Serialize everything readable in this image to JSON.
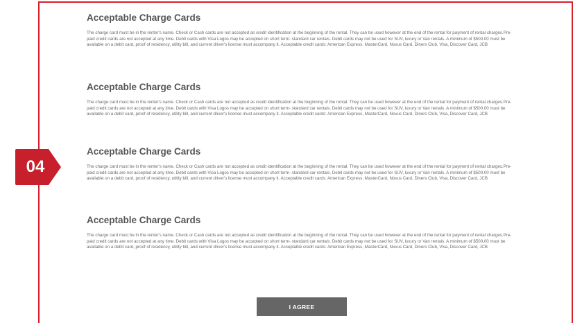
{
  "step": {
    "number": "04",
    "color": "#c81f2c"
  },
  "panel": {
    "border_color": "#d71f2b"
  },
  "sections": [
    {
      "title": "Acceptable Charge Cards",
      "body": "The charge card must be in the renter's name. Check or Cash cards are not accepted as credit identification at the beginning of the rental. They can be used however at the end of the rental for payment of rental charges.Pre-paid credit cards are not accepted at any time. Debit cards with Visa Logos may be accepted on short term- standard car rentals. Debit cards may not be used for SUV, luxury or Van rentals. A minimum of $500.00 must be available on a debit card, proof of residency, utility bill, and current driver's license must accompany it. Acceptable credit cards: American Express, MasterCard, Novus Card, Diners Club, Visa, Discover Card, JCB"
    },
    {
      "title": "Acceptable Charge Cards",
      "body": "The charge card must be in the renter's name. Check or Cash cards are not accepted as credit identification at the beginning of the rental. They can be used however at the end of the rental for payment of rental charges.Pre-paid credit cards are not accepted at any time. Debit cards with Visa Logos may be accepted on short term- standard car rentals. Debit cards may not be used for SUV, luxury or Van rentals. A minimum of $500.00 must be available on a debit card, proof of residency, utility bill, and current driver's license must accompany it. Acceptable credit cards: American Express, MasterCard, Novus Card, Diners Club, Visa, Discover Card, JCB"
    },
    {
      "title": "Acceptable Charge Cards",
      "body": "The charge card must be in the renter's name. Check or Cash cards are not accepted as credit identification at the beginning of the rental. They can be used however at the end of the rental for payment of rental charges.Pre-paid credit cards are not accepted at any time. Debit cards with Visa Logos may be accepted on short term- standard car rentals. Debit cards may not be used for SUV, luxury or Van rentals. A minimum of $500.00 must be available on a debit card, proof of residency, utility bill, and current driver's license must accompany it. Acceptable credit cards: American Express, MasterCard, Novus Card, Diners Club, Visa, Discover Card, JCB"
    },
    {
      "title": "Acceptable Charge Cards",
      "body": "The charge card must be in the renter's name. Check or Cash cards are not accepted as credit identification at the beginning of the rental. They can be used however at the end of the rental for payment of rental charges.Pre-paid credit cards are not accepted at any time. Debit cards with Visa Logos may be accepted on short term- standard car rentals. Debit cards may not be used for SUV, luxury or Van rentals. A minimum of $500.00 must be available on a debit card, proof of residency, utility bill, and current driver's license must accompany it. Acceptable credit cards: American Express, MasterCard, Novus Card, Diners Club, Visa, Discover Card, JCB"
    }
  ],
  "agree_button": {
    "label": "I AGREE",
    "color": "#666666"
  }
}
